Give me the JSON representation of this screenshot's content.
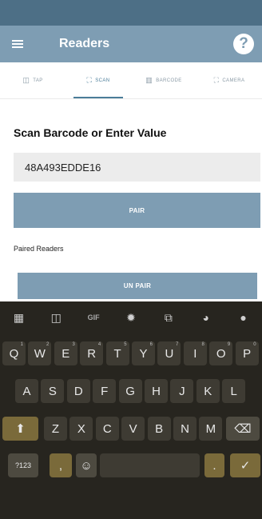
{
  "app": {
    "title": "Readers",
    "help_icon": "help-icon",
    "menu_icon": "menu-icon"
  },
  "tabs": [
    {
      "label": "TAP",
      "icon": "nfc-icon"
    },
    {
      "label": "SCAN",
      "icon": "scan-icon",
      "active": true
    },
    {
      "label": "BARCODE",
      "icon": "barcode-icon"
    },
    {
      "label": "CAMERA",
      "icon": "camera-icon"
    }
  ],
  "scan": {
    "title": "Scan Barcode or Enter Value",
    "value": "48A493EDDE16",
    "pair_label": "PAIR",
    "paired_readers_label": "Paired Readers",
    "unpair_label": "UN PAIR"
  },
  "keyboard": {
    "toolbar": [
      "apps-icon",
      "sticker-icon",
      "GIF",
      "settings-icon",
      "translate-icon",
      "palette-icon",
      "mic-icon"
    ],
    "row1": [
      {
        "k": "Q",
        "h": "1"
      },
      {
        "k": "W",
        "h": "2"
      },
      {
        "k": "E",
        "h": "3"
      },
      {
        "k": "R",
        "h": "4"
      },
      {
        "k": "T",
        "h": "5"
      },
      {
        "k": "Y",
        "h": "6"
      },
      {
        "k": "U",
        "h": "7"
      },
      {
        "k": "I",
        "h": "8"
      },
      {
        "k": "O",
        "h": "9"
      },
      {
        "k": "P",
        "h": "0"
      }
    ],
    "row2": [
      "A",
      "S",
      "D",
      "F",
      "G",
      "H",
      "J",
      "K",
      "L"
    ],
    "row3": [
      "Z",
      "X",
      "C",
      "V",
      "B",
      "N",
      "M"
    ],
    "symbols_label": "?123",
    "comma_label": ",",
    "period_label": ".",
    "colors": {
      "background": "#27251f",
      "key": "#3e3b33",
      "accent": "#7a6a3a"
    }
  },
  "colors": {
    "status_bar": "#4d6f86",
    "app_bar": "#7e9db3",
    "button": "#7e9db3",
    "active_tab": "#4b7d99"
  }
}
